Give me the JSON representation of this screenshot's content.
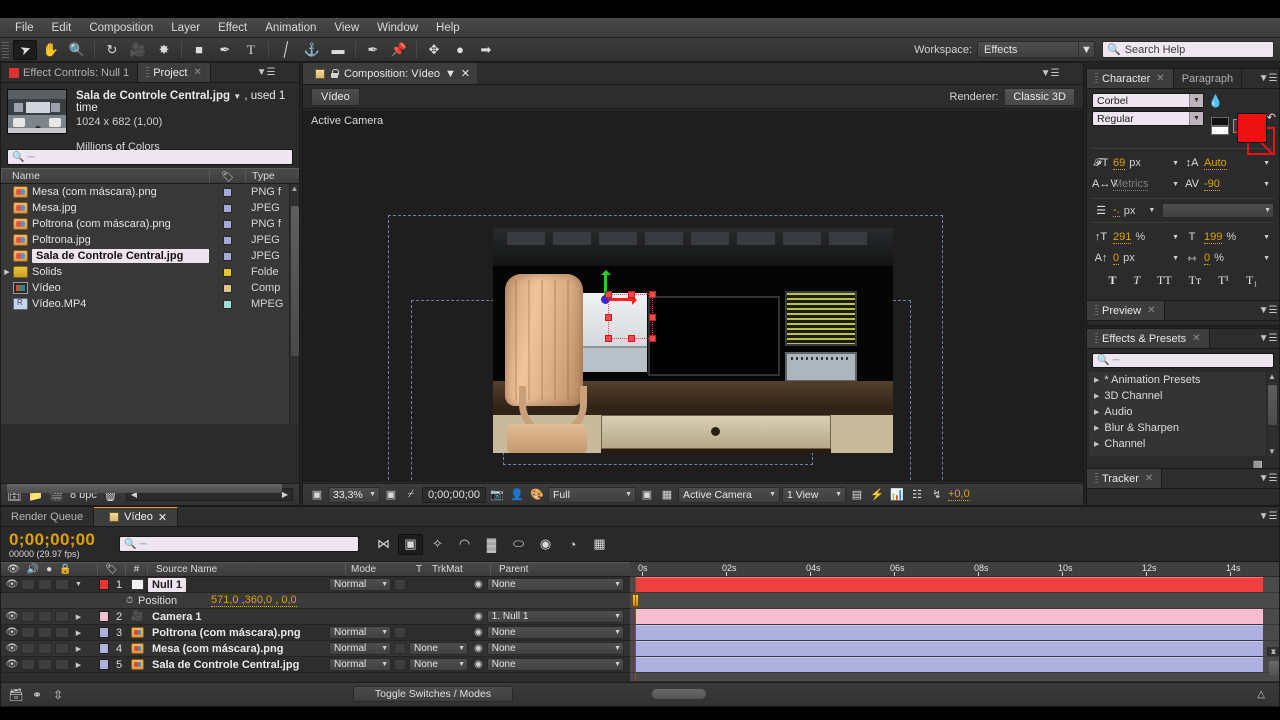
{
  "menubar": {
    "items": [
      "File",
      "Edit",
      "Composition",
      "Layer",
      "Effect",
      "Animation",
      "View",
      "Window",
      "Help"
    ]
  },
  "toolbar": {
    "tools": [
      {
        "name": "selection-tool",
        "glyph": "➤",
        "selected": true
      },
      {
        "name": "hand-tool",
        "glyph": "✋",
        "selected": false
      },
      {
        "name": "zoom-tool",
        "glyph": "🔍",
        "selected": false
      },
      {
        "name": "rotation-tool",
        "glyph": "↻",
        "selected": false
      },
      {
        "name": "camera-tool",
        "glyph": "🎥",
        "selected": false
      },
      {
        "name": "pan-behind-tool",
        "glyph": "✸",
        "selected": false
      },
      {
        "name": "shape-tool",
        "glyph": "■",
        "selected": false
      },
      {
        "name": "pen-tool",
        "glyph": "✒",
        "selected": false
      },
      {
        "name": "type-tool",
        "glyph": "T",
        "selected": false
      },
      {
        "name": "brush-tool",
        "glyph": "╱",
        "selected": false
      },
      {
        "name": "clone-stamp-tool",
        "glyph": "⚓",
        "selected": false
      },
      {
        "name": "eraser-tool",
        "glyph": "▰",
        "selected": false
      },
      {
        "name": "roto-brush-tool",
        "glyph": "✒",
        "selected": false
      },
      {
        "name": "puppet-pin-tool",
        "glyph": "📌",
        "selected": false
      }
    ],
    "extra_tools": [
      {
        "name": "move-anchor-icon",
        "glyph": "✥"
      },
      {
        "name": "sphere-icon",
        "glyph": "●"
      },
      {
        "name": "pin-icon",
        "glyph": "⚑"
      }
    ],
    "workspace_label": "Workspace:",
    "workspace_value": "Effects",
    "search_help_placeholder": "Search Help"
  },
  "project_panel": {
    "tabs": [
      {
        "label": "Effect Controls: Null 1",
        "active": false,
        "closable": false
      },
      {
        "label": "Project",
        "active": true,
        "closable": true
      }
    ],
    "selected_item": {
      "title": "Sala de Controle Central.jpg",
      "used": ", used 1 time",
      "dimensions": "1024 x 682 (1,00)",
      "color_depth": "Millions of Colors"
    },
    "search_placeholder": "",
    "columns": [
      "Name",
      "Type"
    ],
    "items": [
      {
        "name": "Mesa (com máscara).png",
        "type": "PNG f",
        "icon": "image-icon",
        "swatch": "#a7a7d8",
        "selected": false,
        "indent": false
      },
      {
        "name": "Mesa.jpg",
        "type": "JPEG",
        "icon": "image-icon",
        "swatch": "#a7a7d8",
        "selected": false,
        "indent": false
      },
      {
        "name": "Poltrona (com máscara).png",
        "type": "PNG f",
        "icon": "image-icon",
        "swatch": "#a7a7d8",
        "selected": false,
        "indent": false
      },
      {
        "name": "Poltrona.jpg",
        "type": "JPEG",
        "icon": "image-icon",
        "swatch": "#a7a7d8",
        "selected": false,
        "indent": false
      },
      {
        "name": "Sala de Controle Central.jpg",
        "type": "JPEG",
        "icon": "image-icon",
        "swatch": "#a7a7d8",
        "selected": true,
        "indent": false
      },
      {
        "name": "Solids",
        "type": "Folde",
        "icon": "folder-icon",
        "swatch": "#e2c62c",
        "selected": false,
        "indent": true
      },
      {
        "name": "Vídeo",
        "type": "Comp",
        "icon": "composition-icon",
        "swatch": "#e0c58a",
        "selected": false,
        "indent": false
      },
      {
        "name": "Vídeo.MP4",
        "type": "MPEG",
        "icon": "mp4-icon",
        "swatch": "#9fe0d6",
        "selected": false,
        "indent": false
      }
    ],
    "footer": {
      "bit_depth": "8 bpc",
      "icons": [
        "interpret-footage-icon",
        "new-folder-icon",
        "new-composition-icon",
        "delete-icon"
      ]
    }
  },
  "comp_panel": {
    "tab_label": "Composition: Vídeo",
    "breadcrumb": "Vídeo",
    "renderer_label": "Renderer:",
    "renderer_value": "Classic 3D",
    "view_label": "Active Camera",
    "footer": {
      "magnification": "33,3%",
      "time": "0;00;00;00",
      "resolution": "Full",
      "camera_view": "Active Camera",
      "view_layout": "1 View",
      "exposure": "+0,0",
      "icons": [
        "always-preview-icon",
        "region-of-interest-icon",
        "toggle-transparency-icon",
        "take-snapshot-icon",
        "show-snapshot-icon",
        "show-channel-icon",
        "toggle-mask-icon",
        "toggle-alpha-icon",
        "timeline-icon",
        "comp-flowchart-icon",
        "fast-previews-icon",
        "exposure-icon"
      ]
    }
  },
  "character_panel": {
    "tabs": [
      {
        "label": "Character",
        "active": true,
        "closable": true
      },
      {
        "label": "Paragraph",
        "active": false,
        "closable": false
      }
    ],
    "font_family": "Corbel",
    "font_style": "Regular",
    "font_size": "69",
    "font_size_unit": "px",
    "leading": "Auto",
    "kerning": "Metrics",
    "tracking": "-90",
    "vertical_scale": "291",
    "vertical_scale_unit": "%",
    "horizontal_scale": "199",
    "horizontal_scale_unit": "%",
    "baseline_shift": "0",
    "baseline_unit": "px",
    "tsume": "0",
    "tsume_unit": "%",
    "stroke_width": "-.",
    "stroke_unit": "px",
    "fill_color": "#ee1111",
    "stroke_color": "#ee1111",
    "type_styles": [
      "T",
      "T",
      "TT",
      "Tт",
      "T¹",
      "T₁"
    ]
  },
  "preview_panel": {
    "tab_label": "Preview"
  },
  "effects_panel": {
    "tab_label": "Effects & Presets",
    "search_placeholder": "",
    "categories": [
      "* Animation Presets",
      "3D Channel",
      "Audio",
      "Blur & Sharpen",
      "Channel"
    ]
  },
  "tracker_panel": {
    "tab_label": "Tracker"
  },
  "timeline": {
    "tabs": [
      {
        "label": "Render Queue",
        "active": false,
        "closable": false
      },
      {
        "label": "Vídeo",
        "active": true,
        "closable": true
      }
    ],
    "current_time": "0;00;00;00",
    "frame_info": "00000 (29.97 fps)",
    "search_placeholder": "",
    "tools": [
      {
        "name": "live-update-icon",
        "glyph": "⋈",
        "on": false
      },
      {
        "name": "draft-3d-icon",
        "glyph": "▣",
        "on": true
      },
      {
        "name": "hide-shy-layers-icon",
        "glyph": "✨",
        "on": false
      },
      {
        "name": "motion-blur-icon",
        "glyph": "◠",
        "on": false
      },
      {
        "name": "graph-editor-icon",
        "glyph": "▓",
        "on": false
      },
      {
        "name": "brainstorm-icon",
        "glyph": "⬭",
        "on": false
      },
      {
        "name": "auto-keyframe-icon",
        "glyph": "⊙",
        "on": false
      },
      {
        "name": "frame-blending-icon",
        "glyph": "◔",
        "on": false
      },
      {
        "name": "comp-button-icon",
        "glyph": "▦",
        "on": false
      }
    ],
    "columns": [
      "Source Name",
      "Mode",
      "T",
      "TrkMat",
      "Parent"
    ],
    "ruler_ticks": [
      "0s",
      "02s",
      "04s",
      "06s",
      "08s",
      "10s",
      "12s",
      "14s"
    ],
    "layers": [
      {
        "index": "1",
        "name": "Null 1",
        "icon": "null-layer-icon",
        "color": "#ee3333",
        "mode": "Normal",
        "trkmat": null,
        "parent": "None",
        "selected": true,
        "bar_color": "b-red",
        "expanded": true,
        "property": {
          "label": "Position",
          "value": "571,0 ,360,0 , 0,0"
        }
      },
      {
        "index": "2",
        "name": "Camera 1",
        "icon": "camera-layer-icon",
        "color": "#f3c0d2",
        "mode": null,
        "trkmat": null,
        "parent": "1. Null 1",
        "selected": false,
        "bar_color": "b-pink",
        "expanded": false,
        "property": null
      },
      {
        "index": "3",
        "name": "Poltrona (com máscara).png",
        "icon": "image-layer-icon",
        "color": "#adafdf",
        "mode": "Normal",
        "trkmat": null,
        "parent": "None",
        "selected": false,
        "bar_color": "b-lav",
        "expanded": false,
        "property": null
      },
      {
        "index": "4",
        "name": "Mesa (com máscara).png",
        "icon": "image-layer-icon",
        "color": "#adafdf",
        "mode": "Normal",
        "trkmat": "None",
        "parent": "None",
        "selected": false,
        "bar_color": "b-lav",
        "expanded": false,
        "property": null
      },
      {
        "index": "5",
        "name": "Sala de Controle Central.jpg",
        "icon": "image-layer-icon",
        "color": "#adafdf",
        "mode": "Normal",
        "trkmat": "None",
        "parent": "None",
        "selected": false,
        "bar_color": "b-lav",
        "expanded": false,
        "property": null
      }
    ],
    "footer": {
      "toggle_label": "Toggle Switches / Modes",
      "icons": [
        "comp-family-icon",
        "motion-blur-switch-icon",
        "graph-toggle-icon"
      ]
    }
  }
}
